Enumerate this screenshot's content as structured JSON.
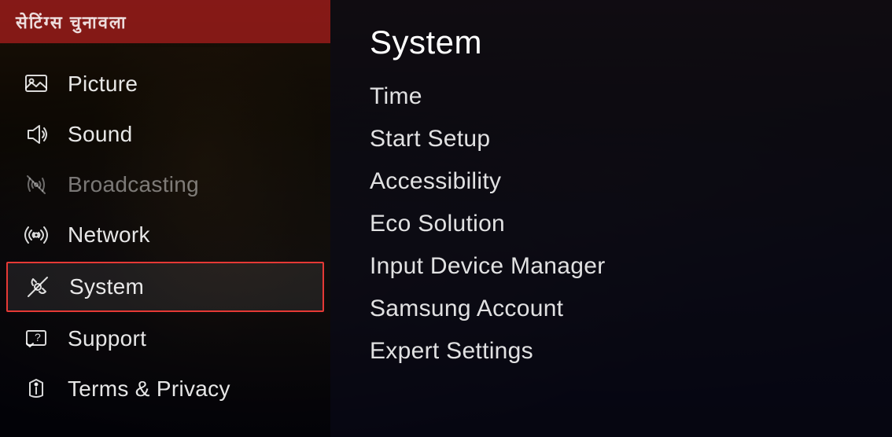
{
  "background": {
    "banner_text": "सेटिंग्स चुनावला"
  },
  "sidebar": {
    "title": "Settings",
    "items": [
      {
        "id": "picture",
        "label": "Picture",
        "icon": "picture-icon",
        "active": false,
        "dimmed": false
      },
      {
        "id": "sound",
        "label": "Sound",
        "icon": "sound-icon",
        "active": false,
        "dimmed": false
      },
      {
        "id": "broadcasting",
        "label": "Broadcasting",
        "icon": "broadcasting-icon",
        "active": false,
        "dimmed": true
      },
      {
        "id": "network",
        "label": "Network",
        "icon": "network-icon",
        "active": false,
        "dimmed": false
      },
      {
        "id": "system",
        "label": "System",
        "icon": "system-icon",
        "active": true,
        "dimmed": false
      },
      {
        "id": "support",
        "label": "Support",
        "icon": "support-icon",
        "active": false,
        "dimmed": false
      },
      {
        "id": "terms",
        "label": "Terms & Privacy",
        "icon": "terms-icon",
        "active": false,
        "dimmed": false
      }
    ]
  },
  "main_panel": {
    "title": "System",
    "items": [
      {
        "id": "time",
        "label": "Time"
      },
      {
        "id": "start-setup",
        "label": "Start Setup"
      },
      {
        "id": "accessibility",
        "label": "Accessibility"
      },
      {
        "id": "eco-solution",
        "label": "Eco Solution"
      },
      {
        "id": "input-device-manager",
        "label": "Input Device Manager"
      },
      {
        "id": "samsung-account",
        "label": "Samsung Account"
      },
      {
        "id": "expert-settings",
        "label": "Expert Settings"
      }
    ]
  }
}
